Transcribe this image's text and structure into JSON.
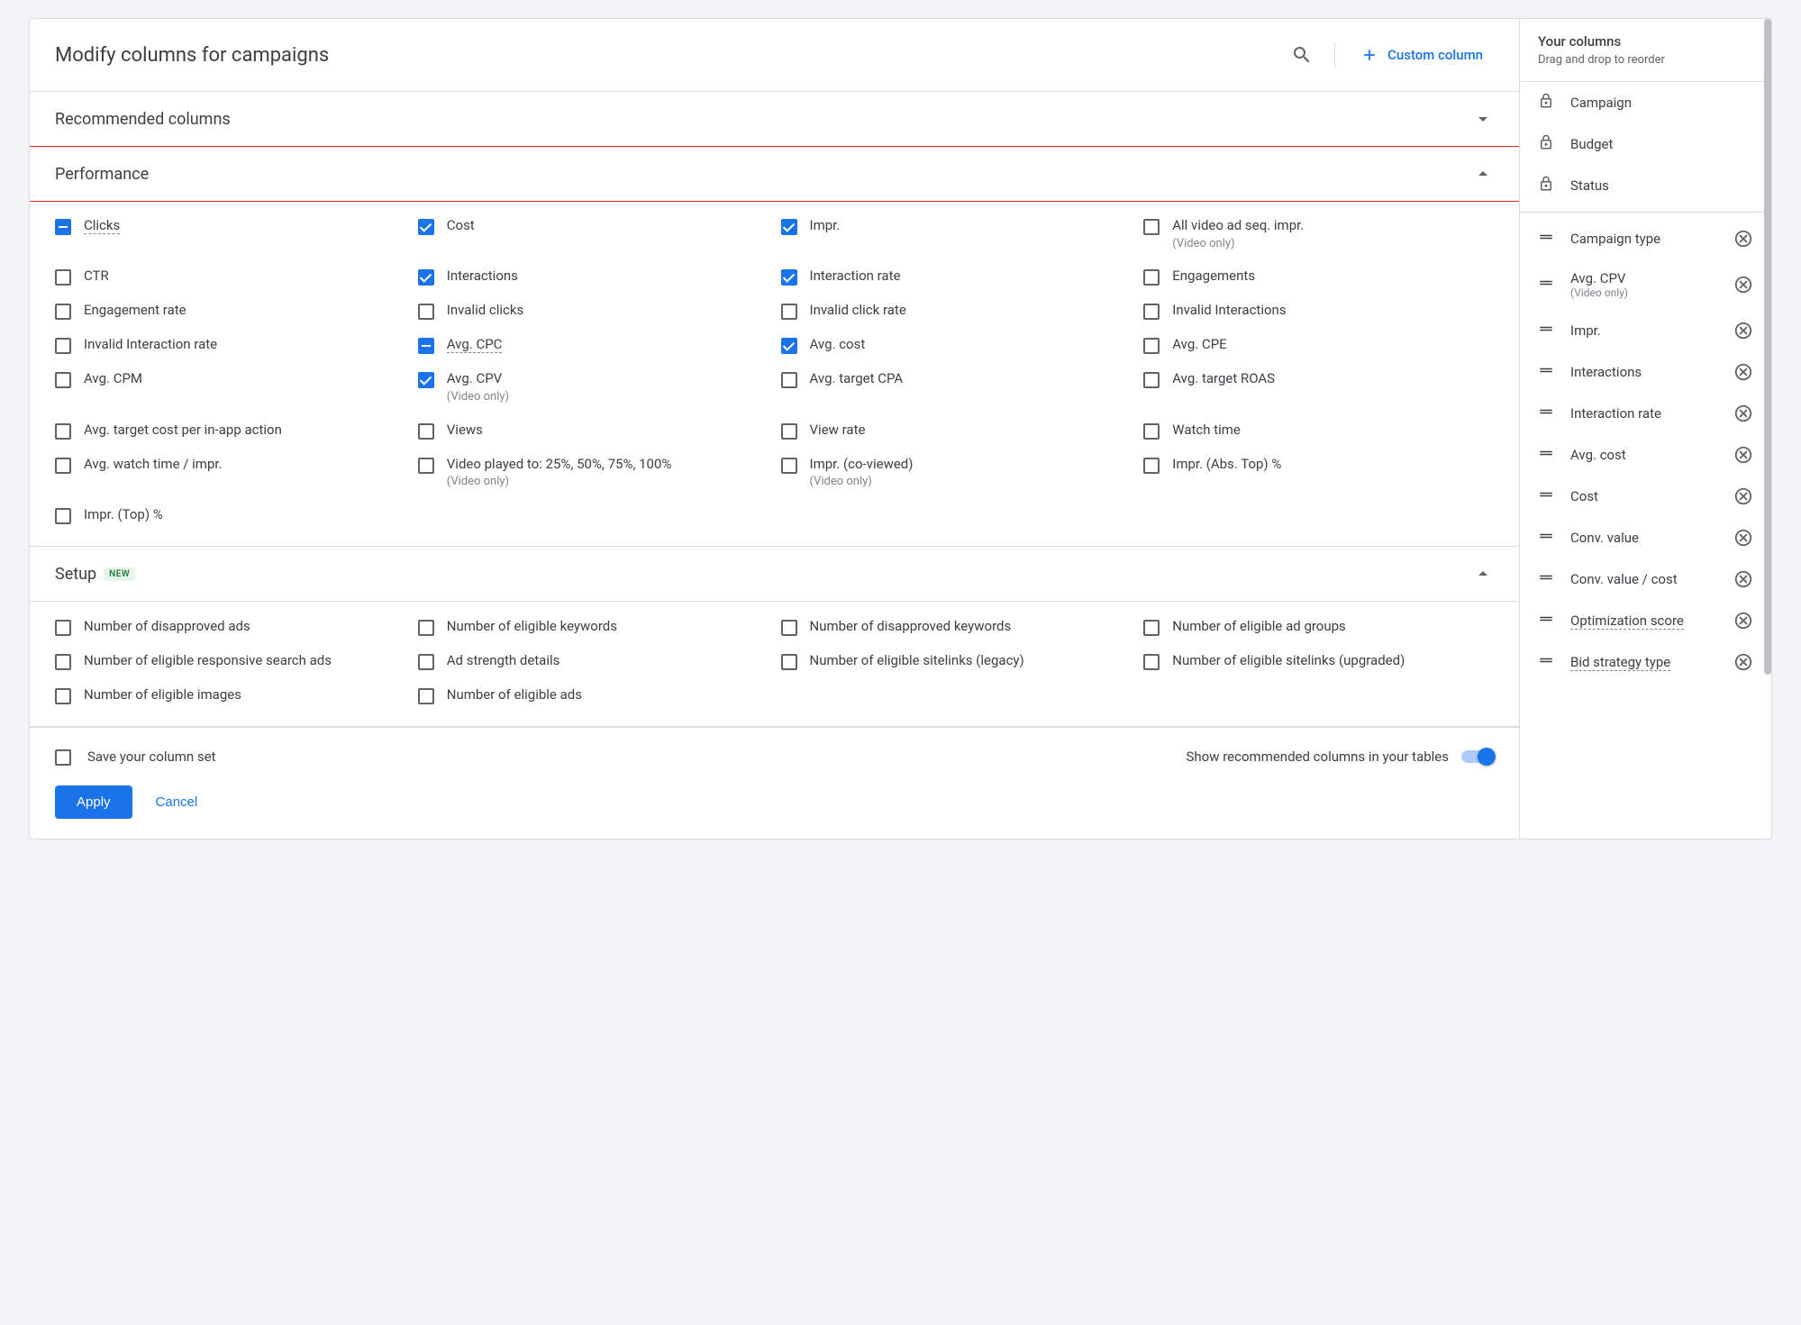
{
  "header": {
    "title": "Modify columns for campaigns",
    "custom_column": "Custom column"
  },
  "sections": {
    "recommended": "Recommended columns",
    "performance": "Performance",
    "setup": "Setup",
    "setup_badge": "NEW"
  },
  "performance_options": [
    {
      "label": "Clicks",
      "state": "indet",
      "dotted": true
    },
    {
      "label": "Cost",
      "state": "checked"
    },
    {
      "label": "Impr.",
      "state": "checked"
    },
    {
      "label": "All video ad seq. impr.",
      "sub": "(Video only)",
      "state": ""
    },
    {
      "label": "CTR",
      "state": ""
    },
    {
      "label": "Interactions",
      "state": "checked"
    },
    {
      "label": "Interaction rate",
      "state": "checked"
    },
    {
      "label": "Engagements",
      "state": ""
    },
    {
      "label": "Engagement rate",
      "state": ""
    },
    {
      "label": "Invalid clicks",
      "state": ""
    },
    {
      "label": "Invalid click rate",
      "state": ""
    },
    {
      "label": "Invalid Interactions",
      "state": ""
    },
    {
      "label": "Invalid Interaction rate",
      "state": ""
    },
    {
      "label": "Avg. CPC",
      "state": "indet",
      "dotted": true
    },
    {
      "label": "Avg. cost",
      "state": "checked"
    },
    {
      "label": "Avg. CPE",
      "state": ""
    },
    {
      "label": "Avg. CPM",
      "state": ""
    },
    {
      "label": "Avg. CPV",
      "sub": "(Video only)",
      "state": "checked"
    },
    {
      "label": "Avg. target CPA",
      "state": ""
    },
    {
      "label": "Avg. target ROAS",
      "state": ""
    },
    {
      "label": "Avg. target cost per in-app action",
      "state": ""
    },
    {
      "label": "Views",
      "state": ""
    },
    {
      "label": "View rate",
      "state": ""
    },
    {
      "label": "Watch time",
      "state": ""
    },
    {
      "label": "Avg. watch time / impr.",
      "state": ""
    },
    {
      "label": "Video played to: 25%, 50%, 75%, 100%",
      "sub": "(Video only)",
      "state": ""
    },
    {
      "label": "Impr. (co-viewed)",
      "sub": "(Video only)",
      "state": ""
    },
    {
      "label": "Impr. (Abs. Top) %",
      "state": ""
    },
    {
      "label": "Impr. (Top) %",
      "state": ""
    }
  ],
  "setup_options": [
    {
      "label": "Number of disapproved ads"
    },
    {
      "label": "Number of eligible keywords"
    },
    {
      "label": "Number of disapproved keywords"
    },
    {
      "label": "Number of eligible ad groups"
    },
    {
      "label": "Number of eligible responsive search ads"
    },
    {
      "label": "Ad strength details"
    },
    {
      "label": "Number of eligible sitelinks (legacy)"
    },
    {
      "label": "Number of eligible sitelinks (upgraded)"
    },
    {
      "label": "Number of eligible images"
    },
    {
      "label": "Number of eligible ads"
    }
  ],
  "sidebar": {
    "title": "Your columns",
    "subtitle": "Drag and drop to reorder",
    "locked": [
      "Campaign",
      "Budget",
      "Status"
    ],
    "draggable": [
      {
        "label": "Campaign type"
      },
      {
        "label": "Avg. CPV",
        "sub": "(Video only)"
      },
      {
        "label": "Impr."
      },
      {
        "label": "Interactions"
      },
      {
        "label": "Interaction rate"
      },
      {
        "label": "Avg. cost"
      },
      {
        "label": "Cost"
      },
      {
        "label": "Conv. value"
      },
      {
        "label": "Conv. value / cost"
      },
      {
        "label": "Optimization score",
        "dotted": true
      },
      {
        "label": "Bid strategy type",
        "dotted": true
      }
    ]
  },
  "footer": {
    "save_set": "Save your column set",
    "show_recommended": "Show recommended columns in your tables",
    "apply": "Apply",
    "cancel": "Cancel"
  }
}
